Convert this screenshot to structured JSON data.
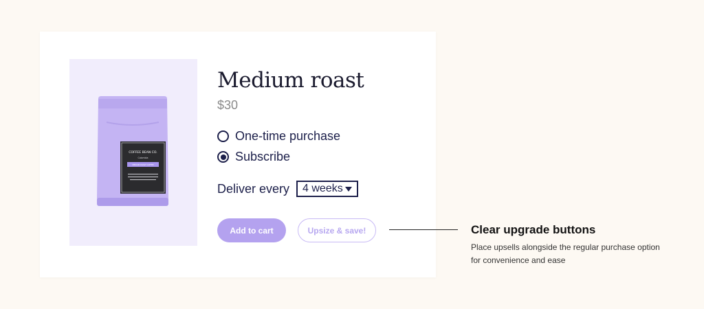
{
  "product": {
    "title": "Medium roast",
    "price": "$30",
    "image_icon": "coffee-bag",
    "bag_brand": "COFFEE BEAN CO.",
    "bag_subtitle": "Colombia",
    "bag_tag": "MEDIUM ROAST COFFEE",
    "bag_text": "Organically sourced, sustainably harvested and roasted to perfection"
  },
  "purchase": {
    "options": [
      {
        "label": "One-time purchase",
        "selected": false
      },
      {
        "label": "Subscribe",
        "selected": true
      }
    ],
    "deliver_label": "Deliver every",
    "frequency": "4 weeks"
  },
  "buttons": {
    "add_to_cart": "Add to cart",
    "upsize": "Upsize & save!"
  },
  "callout": {
    "title": "Clear upgrade buttons",
    "body": "Place upsells alongside the regular purchase option for convenience and ease"
  },
  "colors": {
    "background": "#fdf9f3",
    "accent": "#b4a2ef",
    "navy": "#1c1f4a",
    "image_bg": "#f1edfc"
  }
}
